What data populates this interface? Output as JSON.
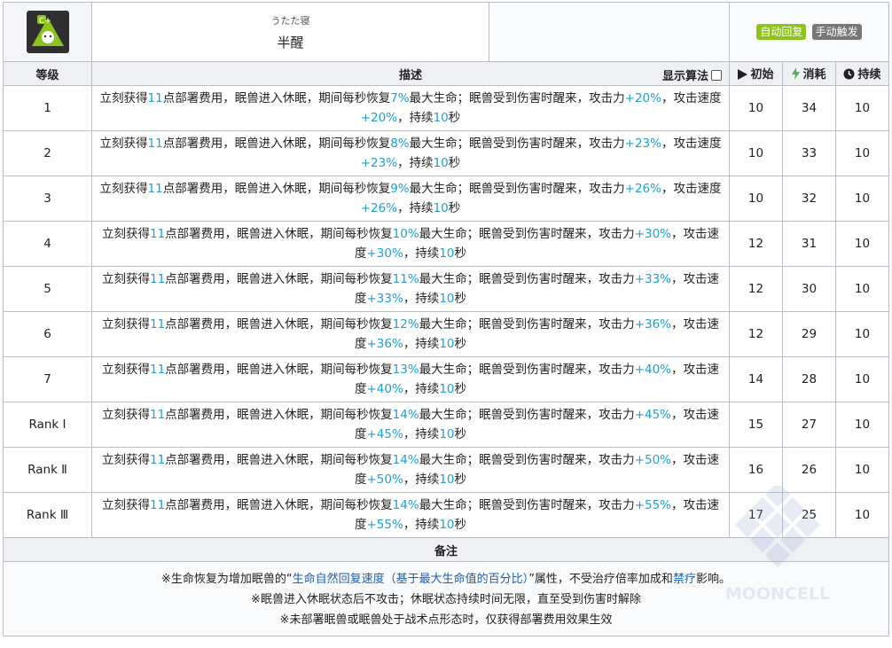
{
  "skill": {
    "name_jp": "うたた寝",
    "name_cn": "半醒",
    "tags": [
      "自动回复",
      "手动触发"
    ]
  },
  "columns": {
    "level": "等级",
    "description": "描述",
    "show_algo": "显示算法",
    "initial": "初始",
    "cost": "消耗",
    "duration": "持续"
  },
  "rows": [
    {
      "level": "1",
      "text1": "立刻获得",
      "dp": "11",
      "text2": "点部署费用，眠兽进入休眠，期间每秒恢复",
      "hp": "7%",
      "text3": "最大生命；眠兽受到伤害时醒来，攻击力",
      "atk": "+20%",
      "text4": "，攻击速度",
      "aspd": "+20%",
      "text5": "，持续",
      "dur": "10",
      "text6": "秒",
      "initial": "10",
      "cost": "34",
      "duration": "10"
    },
    {
      "level": "2",
      "text1": "立刻获得",
      "dp": "11",
      "text2": "点部署费用，眠兽进入休眠，期间每秒恢复",
      "hp": "8%",
      "text3": "最大生命；眠兽受到伤害时醒来，攻击力",
      "atk": "+23%",
      "text4": "，攻击速度",
      "aspd": "+23%",
      "text5": "，持续",
      "dur": "10",
      "text6": "秒",
      "initial": "10",
      "cost": "33",
      "duration": "10"
    },
    {
      "level": "3",
      "text1": "立刻获得",
      "dp": "11",
      "text2": "点部署费用，眠兽进入休眠，期间每秒恢复",
      "hp": "9%",
      "text3": "最大生命；眠兽受到伤害时醒来，攻击力",
      "atk": "+26%",
      "text4": "，攻击速度",
      "aspd": "+26%",
      "text5": "，持续",
      "dur": "10",
      "text6": "秒",
      "initial": "10",
      "cost": "32",
      "duration": "10"
    },
    {
      "level": "4",
      "text1": "立刻获得",
      "dp": "11",
      "text2": "点部署费用，眠兽进入休眠，期间每秒恢复",
      "hp": "10%",
      "text3": "最大生命；眠兽受到伤害时醒来，攻击力",
      "atk": "+30%",
      "text4": "，攻击速度",
      "aspd": "+30%",
      "text5": "，持续",
      "dur": "10",
      "text6": "秒",
      "initial": "12",
      "cost": "31",
      "duration": "10"
    },
    {
      "level": "5",
      "text1": "立刻获得",
      "dp": "11",
      "text2": "点部署费用，眠兽进入休眠，期间每秒恢复",
      "hp": "11%",
      "text3": "最大生命；眠兽受到伤害时醒来，攻击力",
      "atk": "+33%",
      "text4": "，攻击速度",
      "aspd": "+33%",
      "text5": "，持续",
      "dur": "10",
      "text6": "秒",
      "initial": "12",
      "cost": "30",
      "duration": "10"
    },
    {
      "level": "6",
      "text1": "立刻获得",
      "dp": "11",
      "text2": "点部署费用，眠兽进入休眠，期间每秒恢复",
      "hp": "12%",
      "text3": "最大生命；眠兽受到伤害时醒来，攻击力",
      "atk": "+36%",
      "text4": "，攻击速度",
      "aspd": "+36%",
      "text5": "，持续",
      "dur": "10",
      "text6": "秒",
      "initial": "12",
      "cost": "29",
      "duration": "10"
    },
    {
      "level": "7",
      "text1": "立刻获得",
      "dp": "11",
      "text2": "点部署费用，眠兽进入休眠，期间每秒恢复",
      "hp": "13%",
      "text3": "最大生命；眠兽受到伤害时醒来，攻击力",
      "atk": "+40%",
      "text4": "，攻击速度",
      "aspd": "+40%",
      "text5": "，持续",
      "dur": "10",
      "text6": "秒",
      "initial": "14",
      "cost": "28",
      "duration": "10"
    },
    {
      "level": "Rank Ⅰ",
      "text1": "立刻获得",
      "dp": "11",
      "text2": "点部署费用，眠兽进入休眠，期间每秒恢复",
      "hp": "14%",
      "text3": "最大生命；眠兽受到伤害时醒来，攻击力",
      "atk": "+45%",
      "text4": "，攻击速度",
      "aspd": "+45%",
      "text5": "，持续",
      "dur": "10",
      "text6": "秒",
      "initial": "15",
      "cost": "27",
      "duration": "10"
    },
    {
      "level": "Rank Ⅱ",
      "text1": "立刻获得",
      "dp": "11",
      "text2": "点部署费用，眠兽进入休眠，期间每秒恢复",
      "hp": "14%",
      "text3": "最大生命；眠兽受到伤害时醒来，攻击力",
      "atk": "+50%",
      "text4": "，攻击速度",
      "aspd": "+50%",
      "text5": "，持续",
      "dur": "10",
      "text6": "秒",
      "initial": "16",
      "cost": "26",
      "duration": "10"
    },
    {
      "level": "Rank Ⅲ",
      "text1": "立刻获得",
      "dp": "11",
      "text2": "点部署费用，眠兽进入休眠，期间每秒恢复",
      "hp": "14%",
      "text3": "最大生命；眠兽受到伤害时醒来，攻击力",
      "atk": "+55%",
      "text4": "，攻击速度",
      "aspd": "+55%",
      "text5": "，持续",
      "dur": "10",
      "text6": "秒",
      "initial": "17",
      "cost": "25",
      "duration": "10"
    }
  ],
  "notes": {
    "title": "备注",
    "line1_pre": "※生命恢复为增加眠兽的“",
    "line1_hl": "生命自然回复速度（基于最大生命值的百分比）",
    "line1_mid": "”属性，不受治疗倍率加成和",
    "line1_link": "禁疗",
    "line1_post": "影响。",
    "line2": "※眠兽进入休眠状态后不攻击；休眠状态持续时间无限，直至受到伤害时解除",
    "line3": "※未部署眠兽或眠兽处于战术点形态时，仅获得部署费用效果生效"
  },
  "watermark": "MOONCELL",
  "colors": {
    "number": "#1ea0d2",
    "link": "#1b5fa8",
    "tag_auto": "#8dc21f",
    "tag_manual": "#777777",
    "cost_icon": "#4caf50"
  },
  "icons": {
    "skill": "sleeping-beast-skill-icon",
    "initial": "play-triangle-icon",
    "cost": "lightning-icon",
    "duration": "clock-icon"
  }
}
